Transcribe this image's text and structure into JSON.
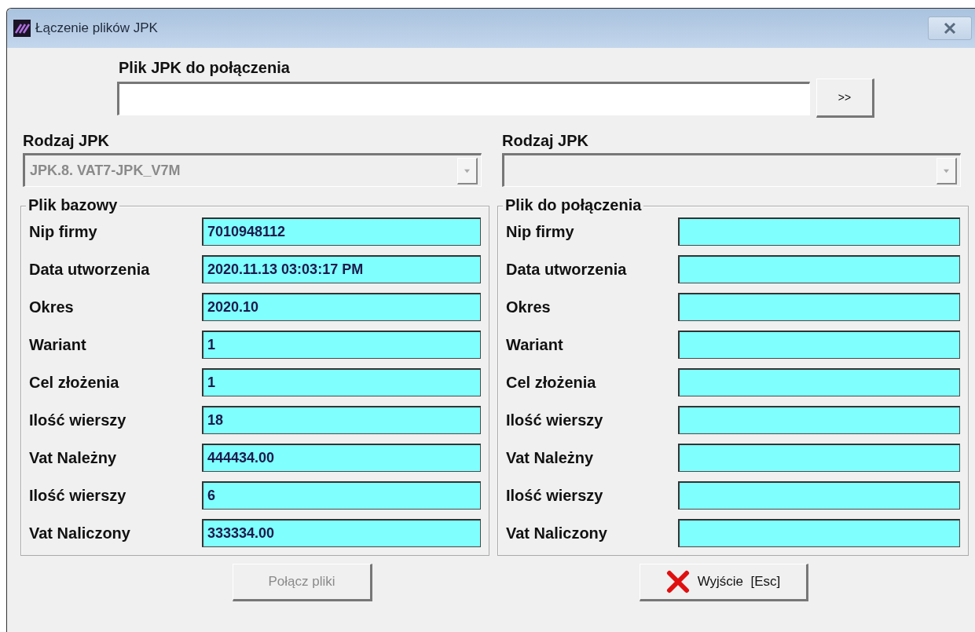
{
  "window": {
    "title": "Łączenie plików JPK"
  },
  "file_picker": {
    "label": "Plik JPK do połączenia",
    "browse_button": ">>"
  },
  "selectors": [
    {
      "label": "Rodzaj JPK",
      "value": "JPK.8. VAT7-JPK_V7M",
      "disabled": true
    },
    {
      "label": "Rodzaj JPK",
      "disabled": true
    }
  ],
  "panels": [
    {
      "title": "Plik bazowy",
      "rows": [
        {
          "label": "Nip firmy",
          "value": "7010948112"
        },
        {
          "label": "Data utworzenia",
          "value": "2020.11.13 03:03:17 PM"
        },
        {
          "label": "Okres",
          "value": "2020.10"
        },
        {
          "label": "Wariant",
          "value": "1"
        },
        {
          "label": "Cel złożenia",
          "value": "1"
        },
        {
          "label": "Ilość wierszy",
          "value": "18"
        },
        {
          "label": "Vat Należny",
          "value": "444434.00"
        },
        {
          "label": "Ilość wierszy",
          "value": "6"
        },
        {
          "label": "Vat Naliczony",
          "value": "333334.00"
        }
      ]
    },
    {
      "title": "Plik do połączenia",
      "rows": [
        {
          "label": "Nip firmy"
        },
        {
          "label": "Data utworzenia"
        },
        {
          "label": "Okres"
        },
        {
          "label": "Wariant"
        },
        {
          "label": "Cel złożenia"
        },
        {
          "label": "Ilość wierszy"
        },
        {
          "label": "Vat Należny"
        },
        {
          "label": "Ilość wierszy"
        },
        {
          "label": "Vat Naliczony"
        }
      ]
    }
  ],
  "buttons": [
    {
      "label": "Połącz pliki",
      "kind": "merge",
      "disabled": true
    },
    {
      "label": "Wyjście  [Esc]",
      "kind": "exit",
      "disabled": false
    }
  ]
}
